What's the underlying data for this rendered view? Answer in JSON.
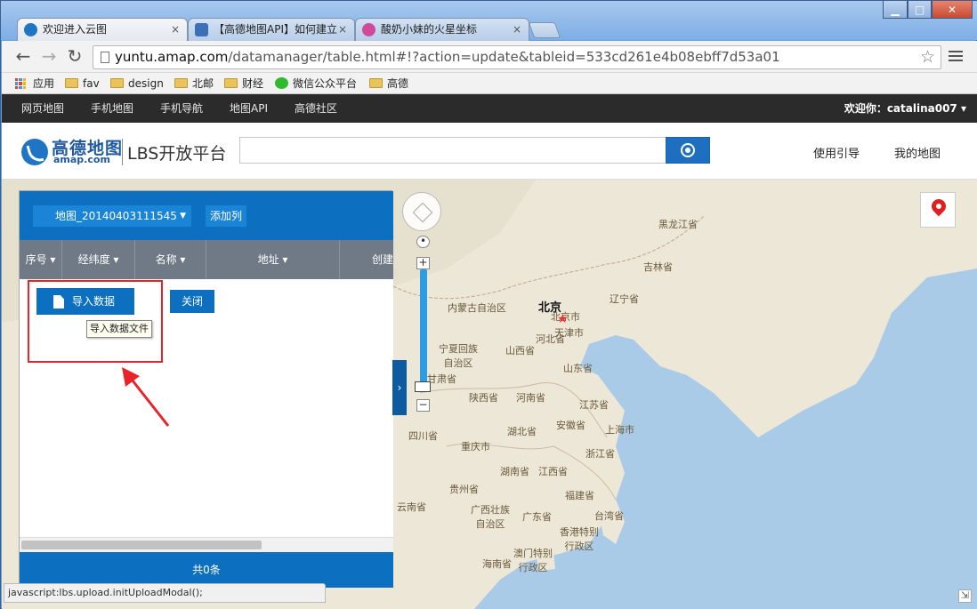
{
  "browser": {
    "tabs": [
      {
        "title": "欢迎进入云图",
        "active": true
      },
      {
        "title": "【高德地图API】如何建立",
        "active": false
      },
      {
        "title": "酸奶小妹的火星坐标",
        "active": false
      }
    ],
    "close_glyph": "×",
    "window_controls": {
      "minimize": "▁",
      "maximize": "□",
      "close": "✕"
    },
    "nav": {
      "back": "←",
      "forward": "→",
      "reload": "↻"
    },
    "url": {
      "host": "yuntu.amap.com",
      "path": "/datamanager/table.html#!?action=update&tableid=533cd261e4b08ebff7d53a01"
    },
    "star": "☆",
    "bookmarks": [
      "应用",
      "fav",
      "design",
      "北邮",
      "财经",
      "微信公众平台",
      "高德"
    ]
  },
  "site": {
    "top_nav": [
      "网页地图",
      "手机地图",
      "手机导航",
      "地图API",
      "高德社区"
    ],
    "welcome": "欢迎你：catalina007",
    "welcome_caret": "▾",
    "logo": {
      "cn": "高德地图",
      "en": "amap.com",
      "lbs": "LBS开放平台"
    },
    "header_links": [
      "使用引导",
      "我的地图"
    ]
  },
  "panel": {
    "map_name": "地图_20140403111545",
    "dropdown_caret": "▼",
    "add_column": "添加列",
    "columns": [
      {
        "label": "序号 ▾"
      },
      {
        "label": "经纬度 ▾"
      },
      {
        "label": "名称 ▾"
      },
      {
        "label": "地址 ▾"
      },
      {
        "label": "创建"
      }
    ],
    "import_button": "导入数据",
    "close_button": "关闭",
    "tooltip": "导入数据文件",
    "footer": "共0条",
    "collapse": "›"
  },
  "map": {
    "zoom_in": "+",
    "zoom_out": "−",
    "labels": {
      "capital": "北京",
      "provinces": [
        "黑龙江省",
        "吉林省",
        "辽宁省",
        "内蒙古自治区",
        "北京市",
        "天津市",
        "河北省",
        "宁夏回族自治区",
        "山西省",
        "山东省",
        "甘肃省",
        "陕西省",
        "河南省",
        "江苏省",
        "四川省",
        "湖北省",
        "安徽省",
        "上海市",
        "重庆市",
        "浙江省",
        "湖南省",
        "江西省",
        "贵州省",
        "福建省",
        "云南省",
        "广西壮族自治区",
        "广东省",
        "台湾省",
        "香港特别行政区",
        "澳门特别行政区",
        "海南省"
      ]
    }
  },
  "status_bar": "javascript:lbs.upload.initUploadModal();",
  "colors": {
    "panel_blue": "#0c6fc0",
    "header_dark": "#2b2b2b",
    "highlight_red": "#e8242a"
  }
}
